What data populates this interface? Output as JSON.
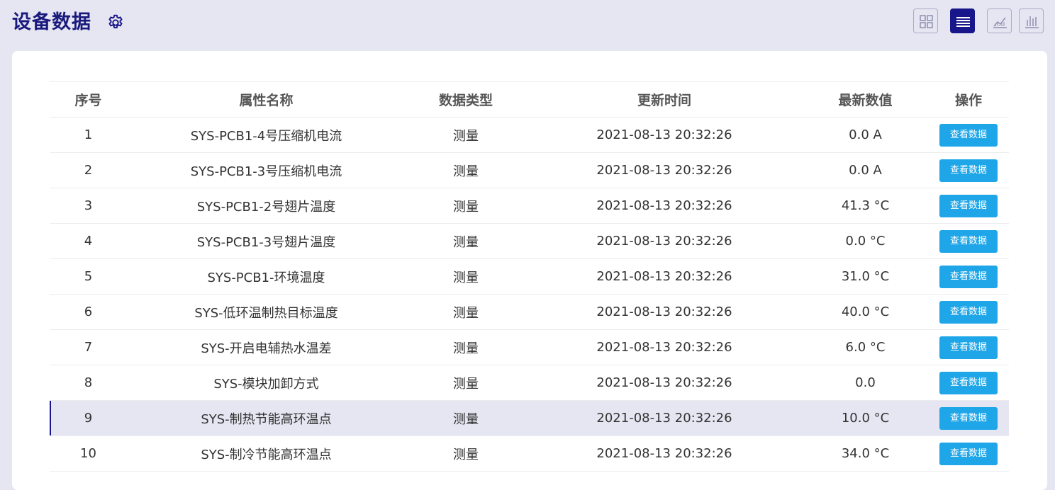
{
  "header": {
    "title": "设备数据",
    "icons": [
      "gear-icon",
      "grid-view-icon",
      "list-view-icon",
      "area-chart-icon",
      "bar-chart-icon"
    ],
    "active_view": "list",
    "accent_color": "#17168a"
  },
  "table": {
    "columns": [
      "序号",
      "属性名称",
      "数据类型",
      "更新时间",
      "最新数值",
      "操作"
    ],
    "action_label": "查看数据",
    "button_color": "#1ea6e8",
    "selected_row": 9,
    "rows": [
      {
        "index": "1",
        "name": "SYS-PCB1-4号压缩机电流",
        "type": "测量",
        "time": "2021-08-13 20:32:26",
        "value": "0.0 A"
      },
      {
        "index": "2",
        "name": "SYS-PCB1-3号压缩机电流",
        "type": "测量",
        "time": "2021-08-13 20:32:26",
        "value": "0.0 A"
      },
      {
        "index": "3",
        "name": "SYS-PCB1-2号翅片温度",
        "type": "测量",
        "time": "2021-08-13 20:32:26",
        "value": "41.3 °C"
      },
      {
        "index": "4",
        "name": "SYS-PCB1-3号翅片温度",
        "type": "测量",
        "time": "2021-08-13 20:32:26",
        "value": "0.0 °C"
      },
      {
        "index": "5",
        "name": "SYS-PCB1-环境温度",
        "type": "测量",
        "time": "2021-08-13 20:32:26",
        "value": "31.0 °C"
      },
      {
        "index": "6",
        "name": "SYS-低环温制热目标温度",
        "type": "测量",
        "time": "2021-08-13 20:32:26",
        "value": "40.0 °C"
      },
      {
        "index": "7",
        "name": "SYS-开启电辅热水温差",
        "type": "测量",
        "time": "2021-08-13 20:32:26",
        "value": "6.0 °C"
      },
      {
        "index": "8",
        "name": "SYS-模块加卸方式",
        "type": "测量",
        "time": "2021-08-13 20:32:26",
        "value": "0.0"
      },
      {
        "index": "9",
        "name": "SYS-制热节能高环温点",
        "type": "测量",
        "time": "2021-08-13 20:32:26",
        "value": "10.0 °C"
      },
      {
        "index": "10",
        "name": "SYS-制冷节能高环温点",
        "type": "测量",
        "time": "2021-08-13 20:32:26",
        "value": "34.0 °C"
      }
    ]
  }
}
